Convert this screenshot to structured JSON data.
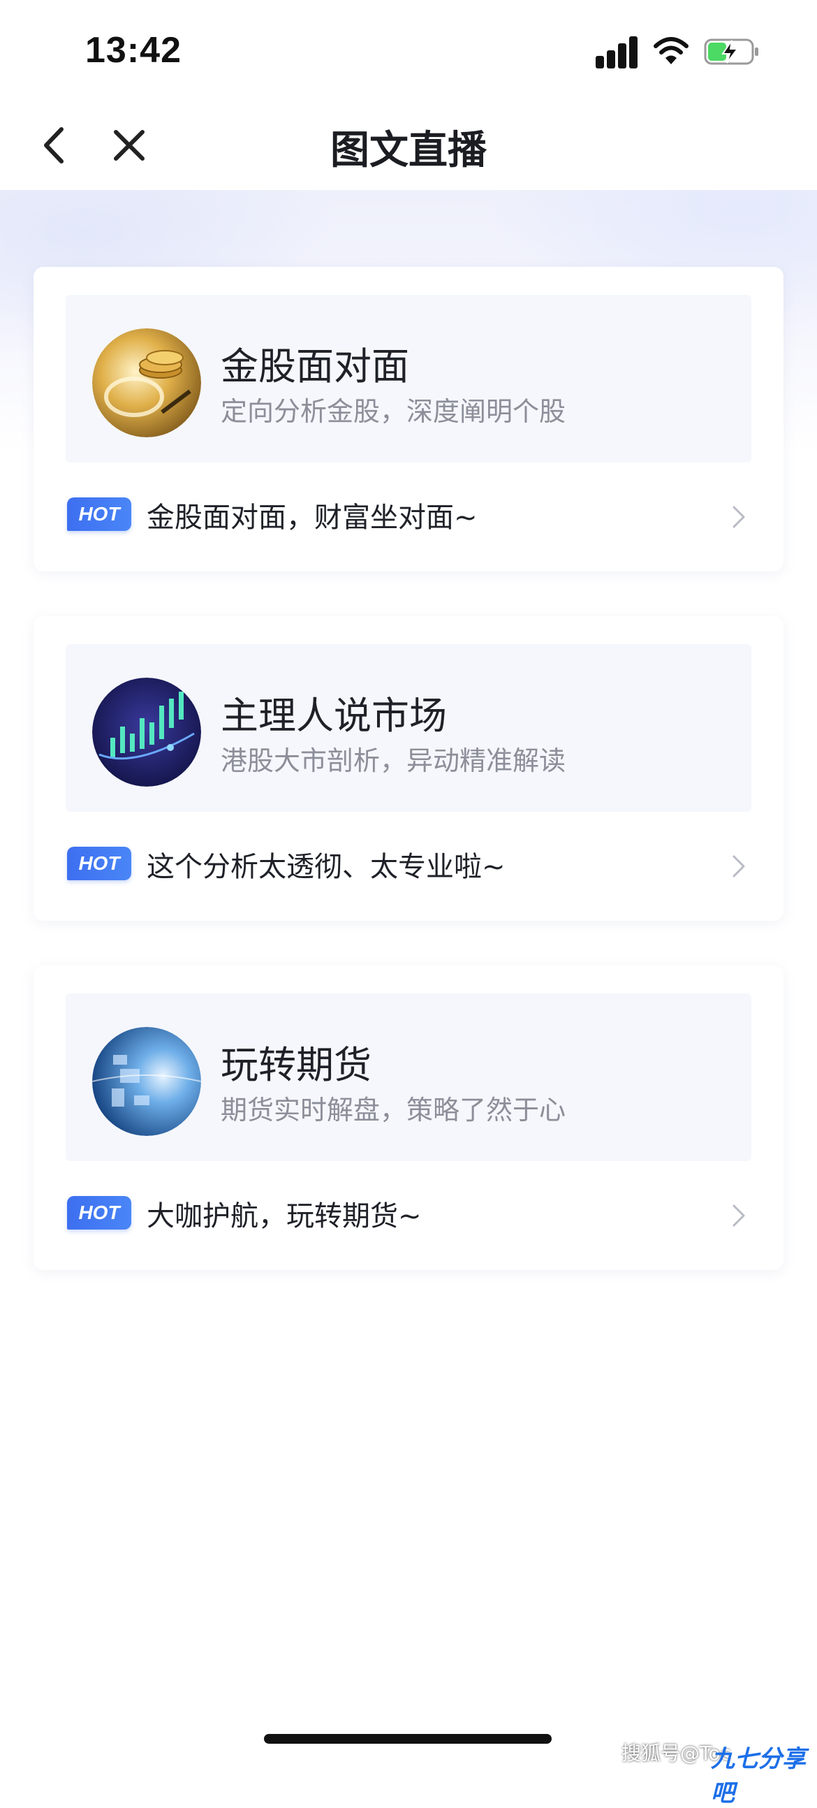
{
  "status_bar": {
    "time": "13:42"
  },
  "nav": {
    "title": "图文直播"
  },
  "cards": [
    {
      "title": "金股面对面",
      "subtitle": "定向分析金股，深度阐明个股",
      "badge": "HOT",
      "hot_text": "金股面对面，财富坐对面~",
      "icon": "gold-coins-icon"
    },
    {
      "title": "主理人说市场",
      "subtitle": "港股大市剖析，异动精准解读",
      "badge": "HOT",
      "hot_text": "这个分析太透彻、太专业啦~",
      "icon": "candlestick-chart-icon"
    },
    {
      "title": "玩转期货",
      "subtitle": "期货实时解盘，策略了然于心",
      "badge": "HOT",
      "hot_text": "大咖护航，玩转期货~",
      "icon": "globe-icon"
    }
  ],
  "watermark": {
    "text": "搜狐号@Toc",
    "logo": "九七分享吧"
  },
  "colors": {
    "accent": "#3d6ff0",
    "title": "#1f2128",
    "subtitle": "#8c8f99",
    "banner_bg": "#f5f7fc"
  }
}
